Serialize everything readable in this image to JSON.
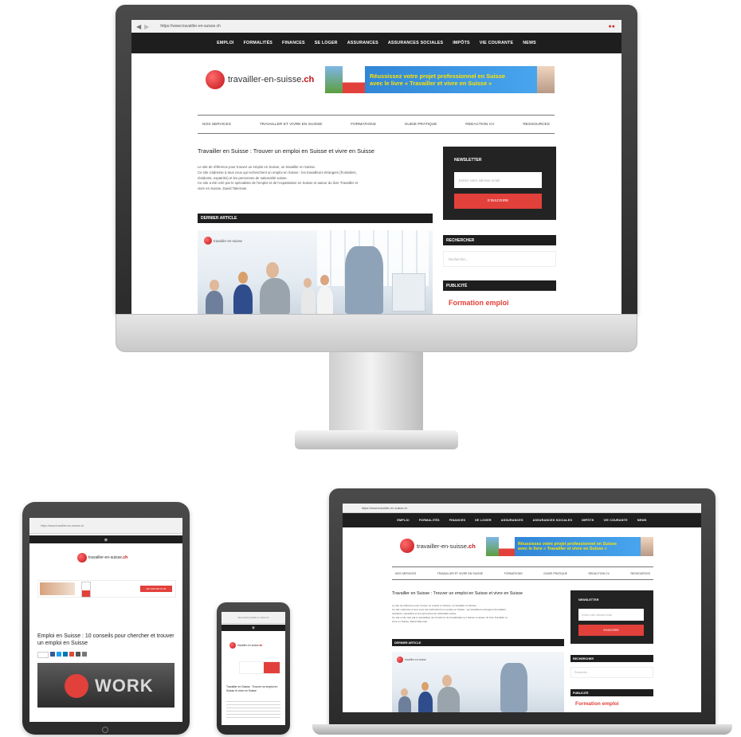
{
  "site": {
    "url": "https://www.travailler-en-suisse.ch",
    "logo_text": "travailler-en-suisse",
    "logo_suffix": ".ch",
    "nav": [
      "EMPLOI",
      "FORMALITÉS",
      "FINANCES",
      "SE LOGER",
      "ASSURANCES",
      "ASSURANCES SOCIALES",
      "IMPÔTS",
      "VIE COURANTE",
      "NEWS"
    ],
    "subnav": [
      "NOS SERVICES",
      "TRAVAILLER ET VIVRE EN SUISSE",
      "FORMATIONS",
      "GUIDE PRATIQUE",
      "REDACTION CV",
      "RESSOURCES"
    ],
    "banner_text_1": "Réussissez votre projet professionnel en Suisse",
    "banner_text_2": "avec le livre « Travailler et vivre en Suisse »",
    "page_title": "Travailler en Suisse : Trouver un emploi en Suisse et vivre en Suisse",
    "intro_lines": [
      "Le site de référence pour trouver un emploi en Suisse, un travailler en Suisse.",
      "Ce site s'adresse à tous ceux qui recherchent un emploi en Suisse : les travailleurs étrangers (frontaliers,",
      "résidents, expatriés) et les personnes de nationalité suisse.",
      "Ce site a été créé par le spécialiste de l'emploi et de l'expatriation en Suisse et auteur du livre Travailler et",
      "vivre en Suisse, David Talerman."
    ],
    "last_article_label": "DERNIER ARTICLE",
    "article_logo_text": "travailler-en-suisse",
    "newsletter_label": "NEWSLETTER",
    "newsletter_placeholder": "Entrez votre adresse email",
    "newsletter_button": "S'INSCRIRE",
    "search_label": "RECHERCHER",
    "search_placeholder": "Recherche...",
    "ad_label": "PUBLICITÉ",
    "ad_text": "Formation emploi"
  },
  "tablet": {
    "title": "Emploi en Suisse : 10 conseils pour chercher et trouver un emploi en Suisse",
    "hero_word": "WORK",
    "banner_button": "EN SAVOIR PLUS"
  },
  "phone": {
    "title": "Travailler en Suisse : Trouver un emploi en Suisse et vivre en Suisse"
  },
  "colors": {
    "brand_red": "#e2403b",
    "nav_dark": "#1e1e1e",
    "banner_blue": "#3a95e6",
    "banner_yellow": "#ffe200"
  }
}
